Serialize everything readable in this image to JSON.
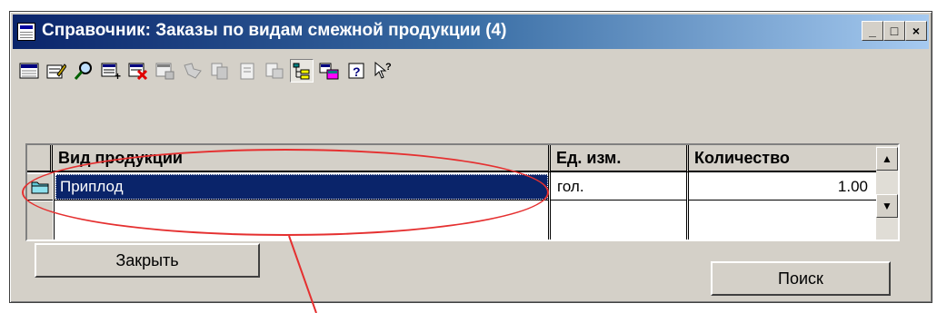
{
  "window": {
    "title": "Справочник: Заказы по видам смежной продукции (4)",
    "controls": {
      "minimize": "_",
      "maximize": "□",
      "close": "×"
    }
  },
  "toolbar": {
    "icons": [
      "list-icon",
      "edit-record-icon",
      "find-icon",
      "add-record-icon",
      "delete-record-icon",
      "copy-record-icon",
      "filter-icon",
      "copy-icon",
      "paste-icon",
      "export-icon",
      "tree-view-icon",
      "import-icon",
      "help-icon",
      "context-help-icon"
    ]
  },
  "table": {
    "columns": [
      "Вид продукции",
      "Ед. изм.",
      "Количество"
    ],
    "rows": [
      {
        "name": "Приплод",
        "unit": "гол.",
        "quantity": "1.00"
      }
    ]
  },
  "buttons": {
    "close": "Закрыть",
    "search": "Поиск"
  },
  "colors": {
    "title_bar": "#0a246a",
    "selection": "#0a246a",
    "annotation": "#e53030"
  }
}
